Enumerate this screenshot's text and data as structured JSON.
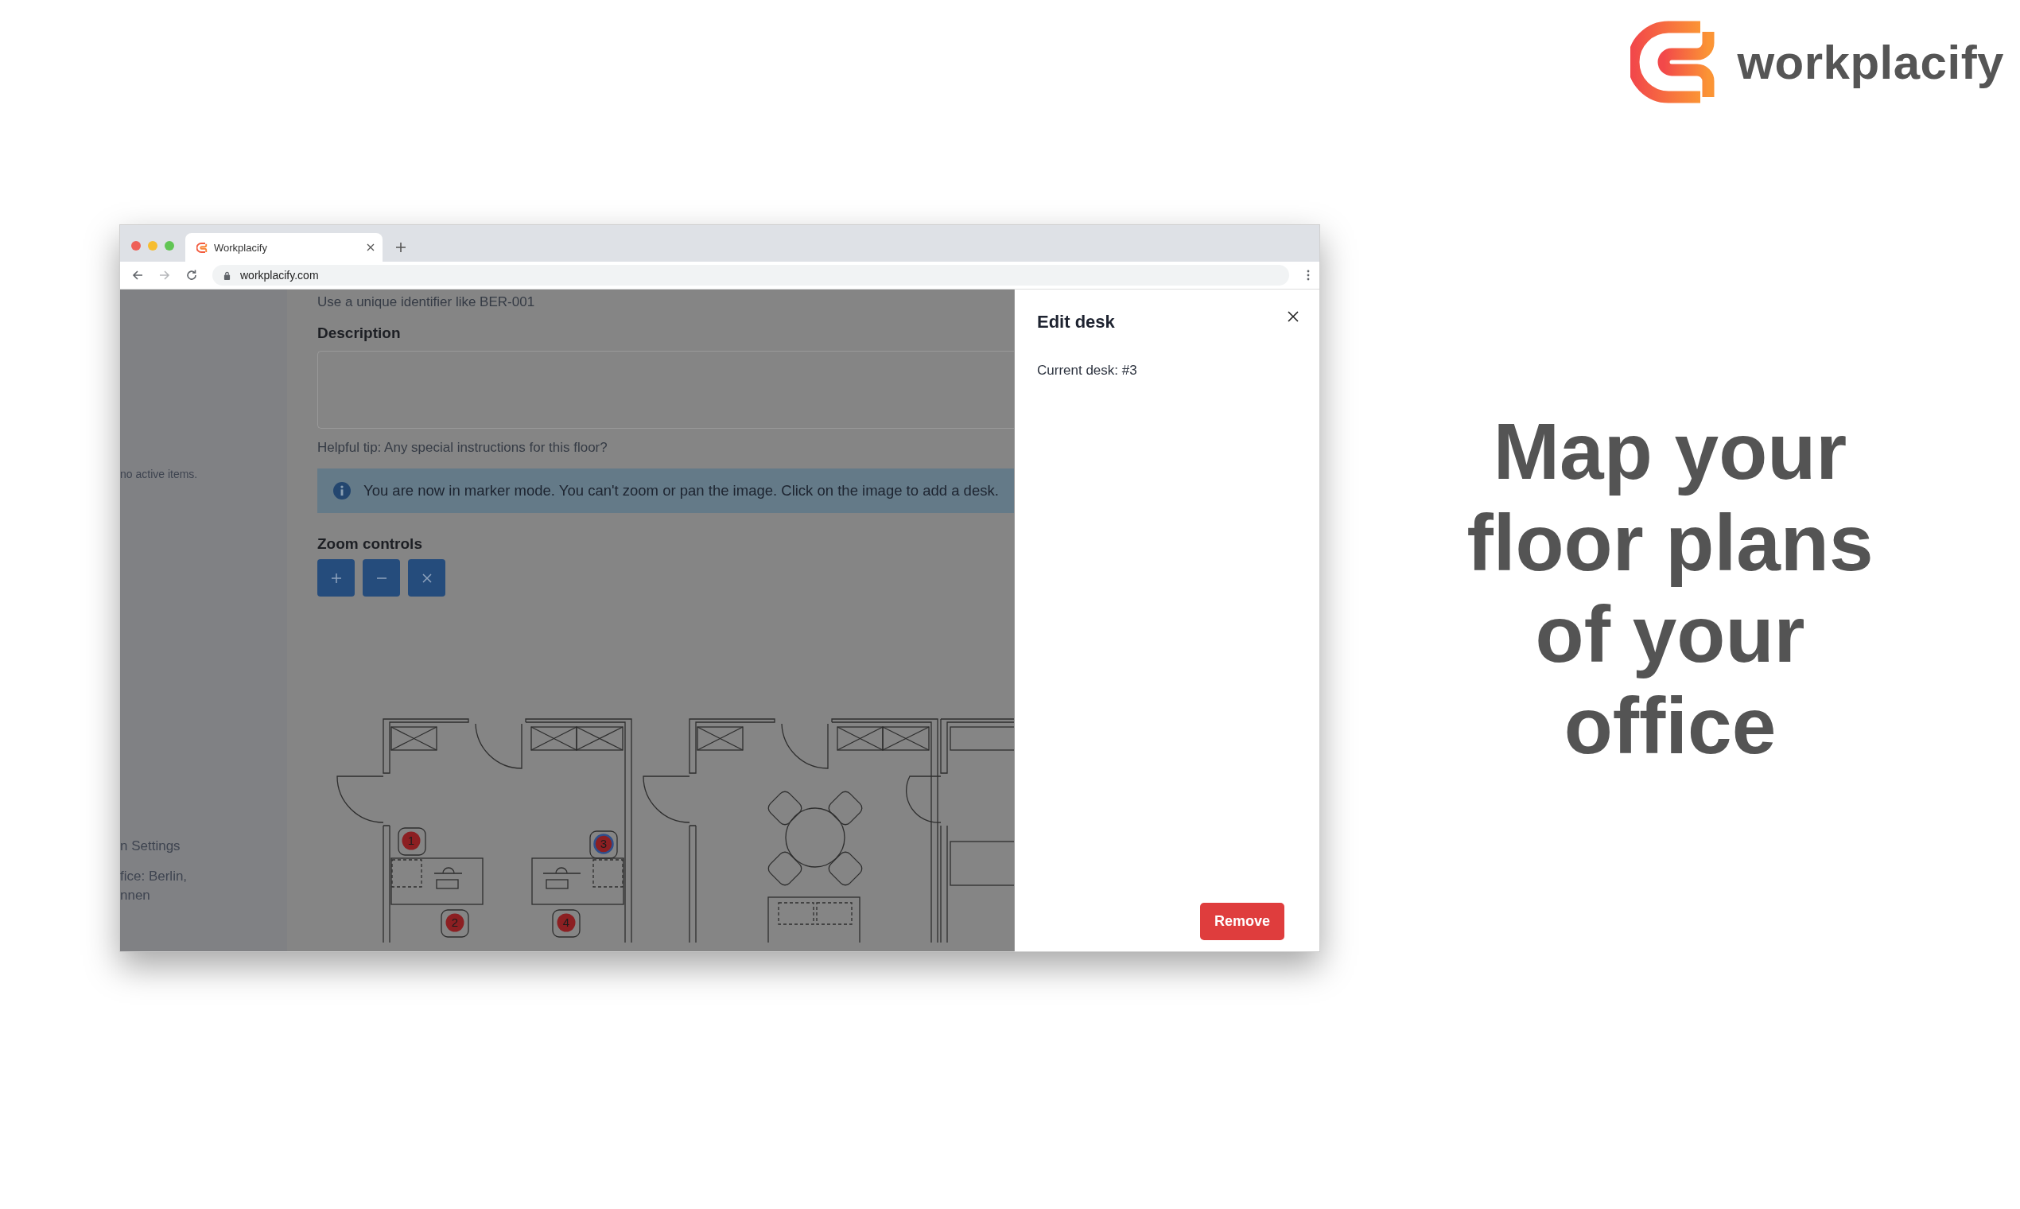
{
  "brand": {
    "name": "workplacify"
  },
  "browser": {
    "tab_title": "Workplacify",
    "url": "workplacify.com"
  },
  "sidebar": {
    "note": "no active items.",
    "items": [
      "n Settings",
      "fice: Berlin,",
      "nnen"
    ]
  },
  "form": {
    "identifier_hint": "Use a unique identifier like BER-001",
    "description_label": "Description",
    "description_hint": "Helpful tip: Any special instructions for this floor?",
    "alert": "You are now in marker mode. You can't zoom or pan the image. Click on the image to add a desk.",
    "zoom_label": "Zoom controls"
  },
  "markers": [
    {
      "label": "1",
      "selected": false
    },
    {
      "label": "2",
      "selected": false
    },
    {
      "label": "3",
      "selected": true
    },
    {
      "label": "4",
      "selected": false
    }
  ],
  "panel": {
    "title": "Edit desk",
    "current": "Current desk: #3",
    "remove": "Remove"
  },
  "headline_lines": [
    "Map your",
    "floor plans",
    "of your",
    "office"
  ]
}
